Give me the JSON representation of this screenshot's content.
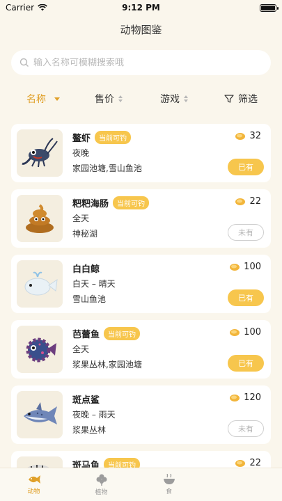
{
  "status_bar": {
    "carrier": "Carrier",
    "time": "9:12 PM"
  },
  "nav": {
    "title": "动物图鉴"
  },
  "search": {
    "placeholder": "输入名称可模糊搜索哦"
  },
  "filters": {
    "name": "名称",
    "price": "售价",
    "game": "游戏",
    "filter": "筛选"
  },
  "items": [
    {
      "name": "鳌虾",
      "badge": "当前可钓",
      "time": "夜晚",
      "location": "家园池塘,雪山鱼池",
      "price": "32",
      "status": "已有",
      "owned": true,
      "icon": "crayfish-icon"
    },
    {
      "name": "粑粑海肠",
      "badge": "当前可钓",
      "time": "全天",
      "location": "神秘湖",
      "price": "22",
      "status": "未有",
      "owned": false,
      "icon": "poop-icon"
    },
    {
      "name": "白白鲸",
      "badge": "",
      "time": "白天 – 晴天",
      "location": "雪山鱼池",
      "price": "100",
      "status": "已有",
      "owned": true,
      "icon": "whale-icon"
    },
    {
      "name": "芭蕾鱼",
      "badge": "当前可钓",
      "time": "全天",
      "location": "浆果丛林,家园池塘",
      "price": "100",
      "status": "已有",
      "owned": true,
      "icon": "ballet-fish-icon"
    },
    {
      "name": "斑点鲨",
      "badge": "",
      "time": "夜晚 – 雨天",
      "location": "浆果丛林",
      "price": "120",
      "status": "未有",
      "owned": false,
      "icon": "shark-icon"
    },
    {
      "name": "斑马鱼",
      "badge": "当前可钓",
      "time": "",
      "location": "",
      "price": "22",
      "status": "",
      "owned": false,
      "icon": "zebra-fish-icon"
    }
  ],
  "tabs": [
    {
      "label": "动物",
      "active": true
    },
    {
      "label": "植物",
      "active": false
    },
    {
      "label": "食",
      "active": false
    }
  ],
  "colors": {
    "accent": "#f7c64d",
    "accent_text": "#e0a028",
    "background": "#faf6ec"
  }
}
